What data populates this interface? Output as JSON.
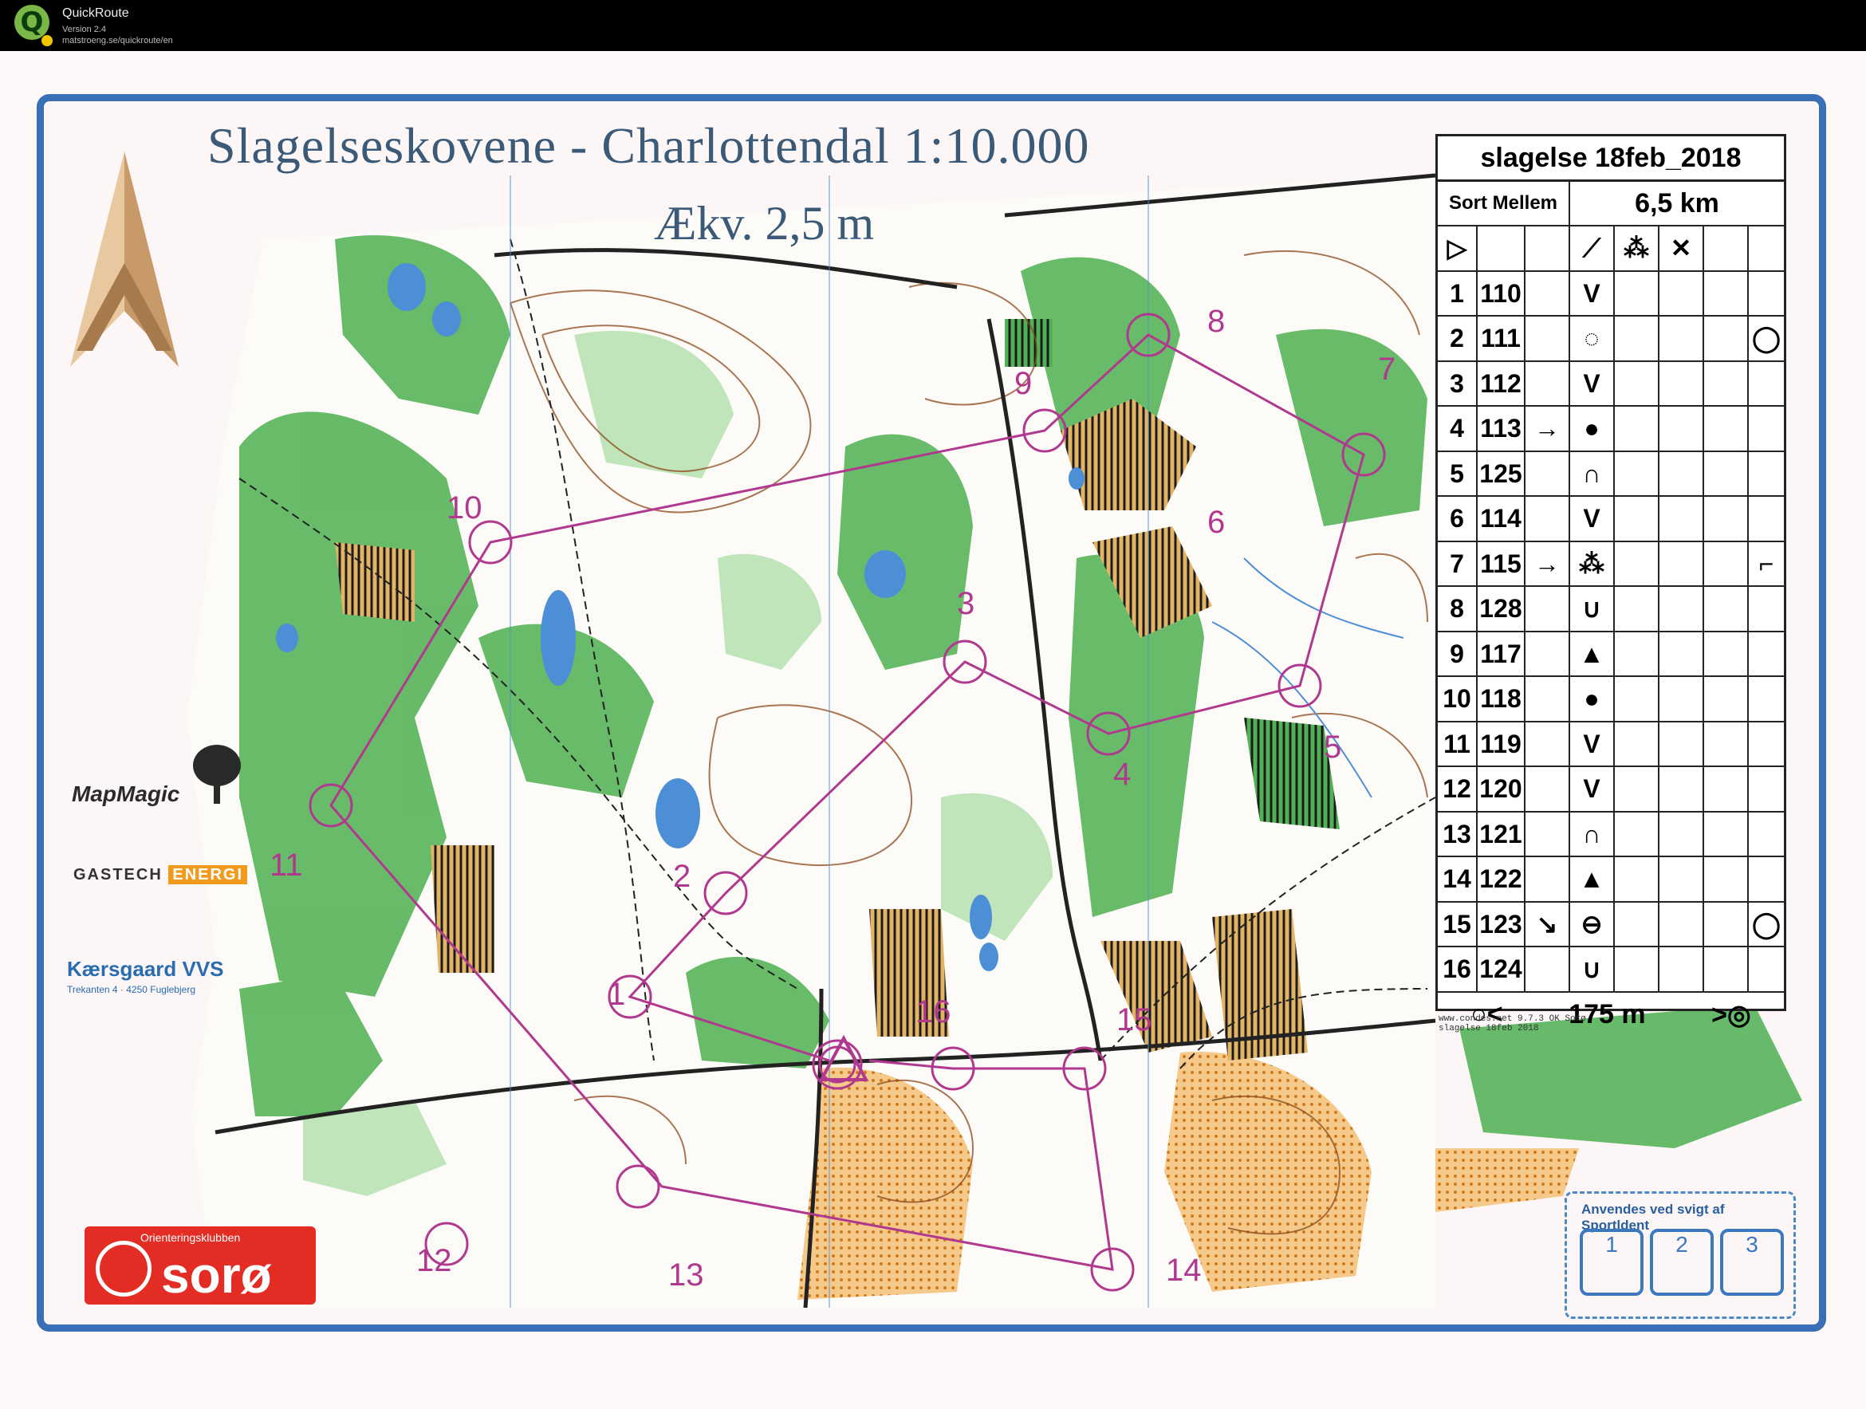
{
  "app": {
    "name": "QuickRoute",
    "version": "Version 2.4",
    "url": "matstroeng.se/quickroute/en"
  },
  "map": {
    "title": "Slagelseskovene - Charlottendal    1:10.000",
    "contour": "Ækv. 2,5 m",
    "control_labels": [
      "1",
      "2",
      "3",
      "4",
      "5",
      "6",
      "7",
      "8",
      "9",
      "10",
      "11",
      "12",
      "13",
      "14",
      "15",
      "16"
    ]
  },
  "description": {
    "event": "slagelse 18feb_2018",
    "class": "Sort Mellem",
    "length": "6,5 km",
    "rows": [
      {
        "no": "1",
        "code": "110",
        "dir": "",
        "feat": "V",
        "misc": ""
      },
      {
        "no": "2",
        "code": "111",
        "dir": "",
        "feat": "◌",
        "misc": "◯"
      },
      {
        "no": "3",
        "code": "112",
        "dir": "",
        "feat": "V",
        "misc": ""
      },
      {
        "no": "4",
        "code": "113",
        "dir": "→",
        "feat": "●",
        "misc": ""
      },
      {
        "no": "5",
        "code": "125",
        "dir": "",
        "feat": "∩",
        "misc": ""
      },
      {
        "no": "6",
        "code": "114",
        "dir": "",
        "feat": "V",
        "misc": ""
      },
      {
        "no": "7",
        "code": "115",
        "dir": "→",
        "feat": "⁂",
        "misc": "⌐"
      },
      {
        "no": "8",
        "code": "128",
        "dir": "",
        "feat": "∪",
        "misc": ""
      },
      {
        "no": "9",
        "code": "117",
        "dir": "",
        "feat": "▲",
        "misc": ""
      },
      {
        "no": "10",
        "code": "118",
        "dir": "",
        "feat": "●",
        "misc": ""
      },
      {
        "no": "11",
        "code": "119",
        "dir": "",
        "feat": "V",
        "misc": ""
      },
      {
        "no": "12",
        "code": "120",
        "dir": "",
        "feat": "V",
        "misc": ""
      },
      {
        "no": "13",
        "code": "121",
        "dir": "",
        "feat": "∩",
        "misc": ""
      },
      {
        "no": "14",
        "code": "122",
        "dir": "",
        "feat": "▲",
        "misc": ""
      },
      {
        "no": "15",
        "code": "123",
        "dir": "↘",
        "feat": "⊖",
        "misc": "◯"
      },
      {
        "no": "16",
        "code": "124",
        "dir": "",
        "feat": "∪",
        "misc": ""
      }
    ],
    "finish_distance": "175 m",
    "credit_line1": "www.condes.net 9.7.3 OK Sorø",
    "credit_line2": "slagelse 18feb 2018"
  },
  "sponsors": {
    "mapmagic": "MapMagic",
    "gastech": "GASTECH",
    "energi": "ENERGI",
    "kaersgaard": "Kærsgaard VVS",
    "kaersgaard_sub": "Trekanten 4 · 4250 Fuglebjerg",
    "club_label": "Orienteringsklubben",
    "club_name": "sorø"
  },
  "backup": {
    "label": "Anvendes ved  svigt af Sportldent",
    "boxes": [
      "1",
      "2",
      "3"
    ]
  },
  "colors": {
    "frame": "#3a6fb8",
    "course": "#b0398f",
    "forest": "#3fa447",
    "open": "#e9a13b",
    "water": "#4d8fd6",
    "contour": "#8c4a1c"
  }
}
